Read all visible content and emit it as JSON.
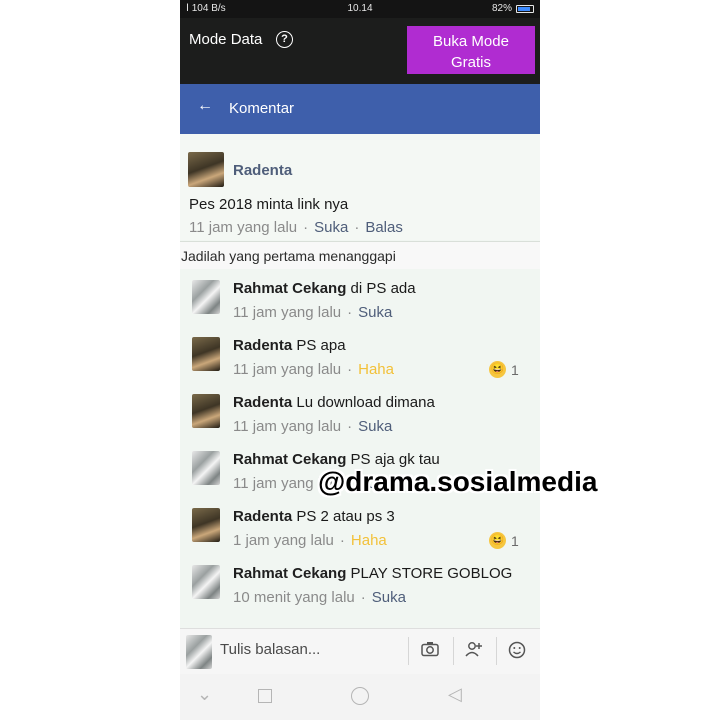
{
  "status_bar": {
    "signal": "Ⅰ 104 B/s",
    "time": "10.14",
    "battery": "82%"
  },
  "data_bar": {
    "label": "Mode Data",
    "help_icon": "question-circle-icon",
    "button_label_line1": "Buka Mode",
    "button_label_line2": "Gratis"
  },
  "header": {
    "title": "Komentar",
    "back_icon": "arrow-left-icon"
  },
  "main_comment": {
    "author": "Radenta",
    "text": "Pes 2018 minta link nya",
    "time": "11 jam yang lalu",
    "like": "Suka",
    "reply": "Balas"
  },
  "first_reply_label": "Jadilah yang pertama menanggapi",
  "replies": [
    {
      "author": "Rahmat Cekang",
      "text": "di PS ada",
      "time": "11 jam yang lalu",
      "action": "Suka",
      "reaction_count": ""
    },
    {
      "author": "Radenta",
      "text": "PS apa",
      "time": "11 jam yang lalu",
      "action": "Haha",
      "reaction_count": "1"
    },
    {
      "author": "Radenta",
      "text": "Lu download dimana",
      "time": "11 jam yang lalu",
      "action": "Suka",
      "reaction_count": ""
    },
    {
      "author": "Rahmat Cekang",
      "text": "PS aja gk tau",
      "time": "11 jam yang lalu",
      "action": "Suka",
      "reaction_count": ""
    },
    {
      "author": "Radenta",
      "text": "PS 2 atau ps 3",
      "time": "1 jam yang lalu",
      "action": "Haha",
      "reaction_count": "1"
    },
    {
      "author": "Rahmat Cekang",
      "text": "PLAY STORE GOBLOG",
      "time": "10 menit yang lalu",
      "action": "Suka",
      "reaction_count": ""
    }
  ],
  "watermark": "@drama.sosialmedia",
  "reply_bar": {
    "placeholder": "Tulis balasan..."
  },
  "colors": {
    "header": "#3e5fab",
    "mode_button": "#b02cd1",
    "haha": "#f2c13a",
    "link": "#4f5e7a"
  }
}
